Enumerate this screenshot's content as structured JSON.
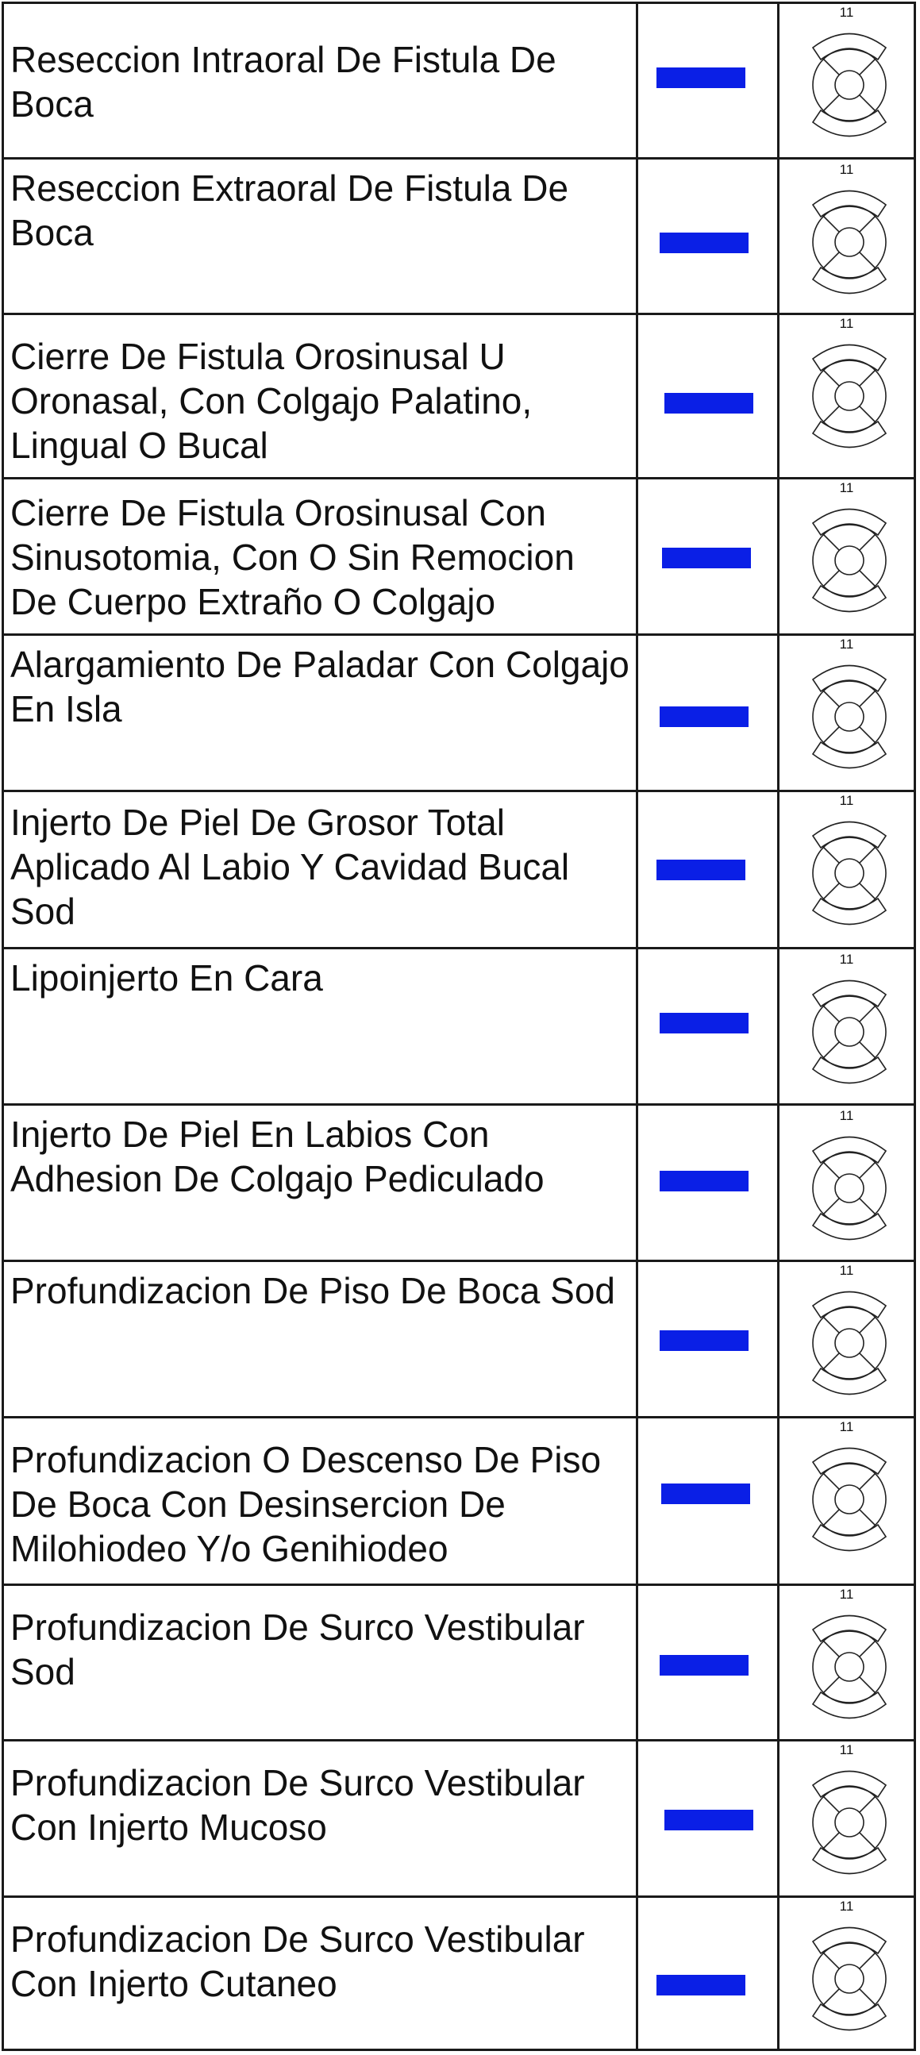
{
  "rows": [
    {
      "text": "Reseccion Intraoral De Fistula De Boca",
      "tooth": "11"
    },
    {
      "text": "Reseccion Extraoral De Fistula De Boca",
      "tooth": "11"
    },
    {
      "text": "Cierre De Fistula Orosinusal U Oronasal, Con Colgajo Palatino, Lingual O Bucal",
      "tooth": "11"
    },
    {
      "text": "Cierre De Fistula Orosinusal Con Sinusotomia, Con O Sin Remocion De Cuerpo Extraño O Colgajo",
      "tooth": "11"
    },
    {
      "text": "Alargamiento De Paladar Con Colgajo En Isla",
      "tooth": "11"
    },
    {
      "text": "Injerto De Piel De Grosor Total Aplicado Al Labio Y Cavidad Bucal Sod",
      "tooth": "11"
    },
    {
      "text": "Lipoinjerto En Cara",
      "tooth": "11"
    },
    {
      "text": "Injerto De Piel En Labios Con Adhesion De Colgajo Pediculado",
      "tooth": "11"
    },
    {
      "text": "Profundizacion De Piso De Boca Sod",
      "tooth": "11"
    },
    {
      "text": "Profundizacion O Descenso De Piso De Boca Con Desinsercion De Milohiodeo Y/o Genihiodeo",
      "tooth": "11"
    },
    {
      "text": "Profundizacion De Surco Vestibular Sod",
      "tooth": "11"
    },
    {
      "text": "Profundizacion De Surco Vestibular Con Injerto Mucoso",
      "tooth": "11"
    },
    {
      "text": "Profundizacion De Surco Vestibular Con Injerto Cutaneo",
      "tooth": "11"
    }
  ],
  "colors": {
    "mark": "#0a1fe6",
    "border": "#1a1a1a"
  }
}
